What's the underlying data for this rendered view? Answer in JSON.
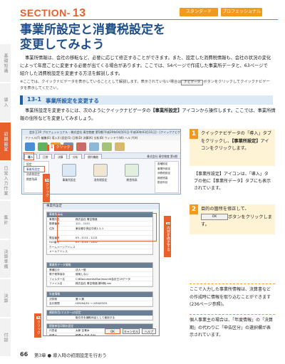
{
  "header": {
    "section_label": "SECTION-",
    "section_number": "13",
    "badges": [
      "スタンダード",
      "プロフェッショナル"
    ],
    "title_line1": "事業所設定と消費税設定を",
    "title_line2": "変更してみよう"
  },
  "side_tabs": [
    {
      "label": "基礎知識",
      "active": false
    },
    {
      "label": "導入",
      "active": false
    },
    {
      "label": "初期設定",
      "active": true
    },
    {
      "label": "日常入力作業",
      "active": false
    },
    {
      "label": "集計",
      "active": false
    },
    {
      "label": "決算準備",
      "active": false
    },
    {
      "label": "決算",
      "active": false
    },
    {
      "label": "付録",
      "active": false
    }
  ],
  "intro": "事業所情報は、会社の移転など、必要に応じて修正することができます。また、設定した消費税情報も、会社の状況の変化によって年度ごとに変更する必要が出てくる場合があります。ここでは、54ページで作成した事業所データと、63ページで紹介した消費税設定を変更する方法を解説します。",
  "note": {
    "before": "※ここでは、クイックナビゲータを表示していることとして解説します。表示されていない場合は",
    "button": "ナビゲータ",
    "after": "ボタンをクリックしてクイックナビゲータを表示してください。"
  },
  "subsection": {
    "number": "13-1",
    "title": "事業所設定を変更する",
    "intro_before": "事業所設定を変更するには、次のようにクイックナビゲータの",
    "intro_bold": "【事業所設定】",
    "intro_after": "アイコンから操作します。ここでは、事業所情報の住所などを変更してみましょう。"
  },
  "window1": {
    "title": "会計王19 プロフェッショナル - 株式会社 青空物産 第5期[平成29年04月01日-平成30年03月31日] - [クイックナビゲータ]",
    "menu": "ファイル(F)  編集(E)  導入(I)  設定(S)  日常(D)  決算(K)  分析(B)  ウィンドウ(W)  ヘルプ(H)",
    "tabs": [
      "導入",
      "日常",
      "決算",
      "分析",
      "便利機能"
    ],
    "fiscal": "株式会社 青空物産 第5期",
    "side_items": [
      "設定",
      "事業所設定",
      "消費税設定",
      "期首残高"
    ],
    "right_items": [
      "各種設定",
      "事業所設定",
      "消費税設定",
      "期首残高",
      "勘定科目"
    ],
    "flow_labels": [
      "事業所設定",
      "消費税設定",
      "期首残高"
    ]
  },
  "callouts": {
    "c1_num": "1",
    "c1_text": "クリック",
    "c2_num": "2",
    "c2_text": "クリック",
    "c3_num": "1",
    "c3_text": "内容を修正する",
    "c4_num": "2",
    "c4_text": "クリック"
  },
  "step1": {
    "number": "1",
    "text1": "クイックナビゲータの「導入」タブをクリックし、",
    "bold": "【事業所設定】",
    "text2": "アイコンをクリックします。"
  },
  "step1_note": "【事業所設定】アイコンは、「導入」タブの他に【事業所データ】タブにも表示されています。",
  "step2": {
    "number": "2",
    "text1": "目的の箇所を修正して、",
    "button": "OK",
    "text2": "ボタンをクリックします。"
  },
  "info1": "ここで入力した事業所情報は、決算書などの作成時に情報を取り込むことができます(236ページ参照)。",
  "info2": "個人事業主の場合は、「年度情報」の「決算期」の代わりに「申告区分」の選択欄が表示されています。",
  "dialog": {
    "title": "事業所設定",
    "groups": [
      {
        "head": "事業所情報",
        "rows": [
          {
            "k": "事業所名",
            "v": "株式会社 青空物産"
          },
          {
            "k": "郵便番号",
            "v": "111 - 1111"
          },
          {
            "k": "住所",
            "v": "東京都中央区中央1-1-1"
          },
          {
            "k": "",
            "v": ""
          },
          {
            "k": "電話番号",
            "v": "03 - 1111 - 1111"
          },
          {
            "k": "FAX番号",
            "v": "03 - 1111 - 2222"
          },
          {
            "k": "ホームページアドレス",
            "v": ""
          },
          {
            "k": "メールアドレス",
            "v": ""
          }
        ]
      },
      {
        "head": "事業所データ情報",
        "rows": [
          {
            "k": "業種区分",
            "v": "法人一般"
          },
          {
            "k": "電子帳簿保存",
            "v": "使用しない"
          },
          {
            "k": "フォルダー名",
            "v": "C:¥Documents¥Sorimachi¥会計王19データ"
          },
          {
            "k": "ファイル名",
            "v": "株式会社 青空物産(第5期).kai"
          }
        ]
      },
      {
        "head": "年度情報",
        "rows": [
          {
            "k": "決算期",
            "v": "第 5 期"
          },
          {
            "k": "会計期間",
            "v": "H29/04/01 ～ H30/03/31"
          }
        ]
      },
      {
        "head": "補助科目(マスター)の設定",
        "rows": [
          {
            "k": "",
            "v": "取引先を補助科目として使用する"
          }
        ]
      },
      {
        "head": "税務申告印刷の設定",
        "rows": [
          {
            "k": "代表者",
            "v": "太郎 空青木"
          },
          {
            "k": "税理士",
            "v": "税理士 花子 会計"
          }
        ]
      }
    ],
    "buttons": [
      "OK",
      "キャンセル",
      "ヘルプ"
    ]
  },
  "footer": {
    "page": "66",
    "text": "第3章 ● 導入時の初期設定を行おう"
  },
  "colors": {
    "accent": "#e8602c",
    "title_blue": "#1f4f8a",
    "badge": "#f39a1e"
  }
}
